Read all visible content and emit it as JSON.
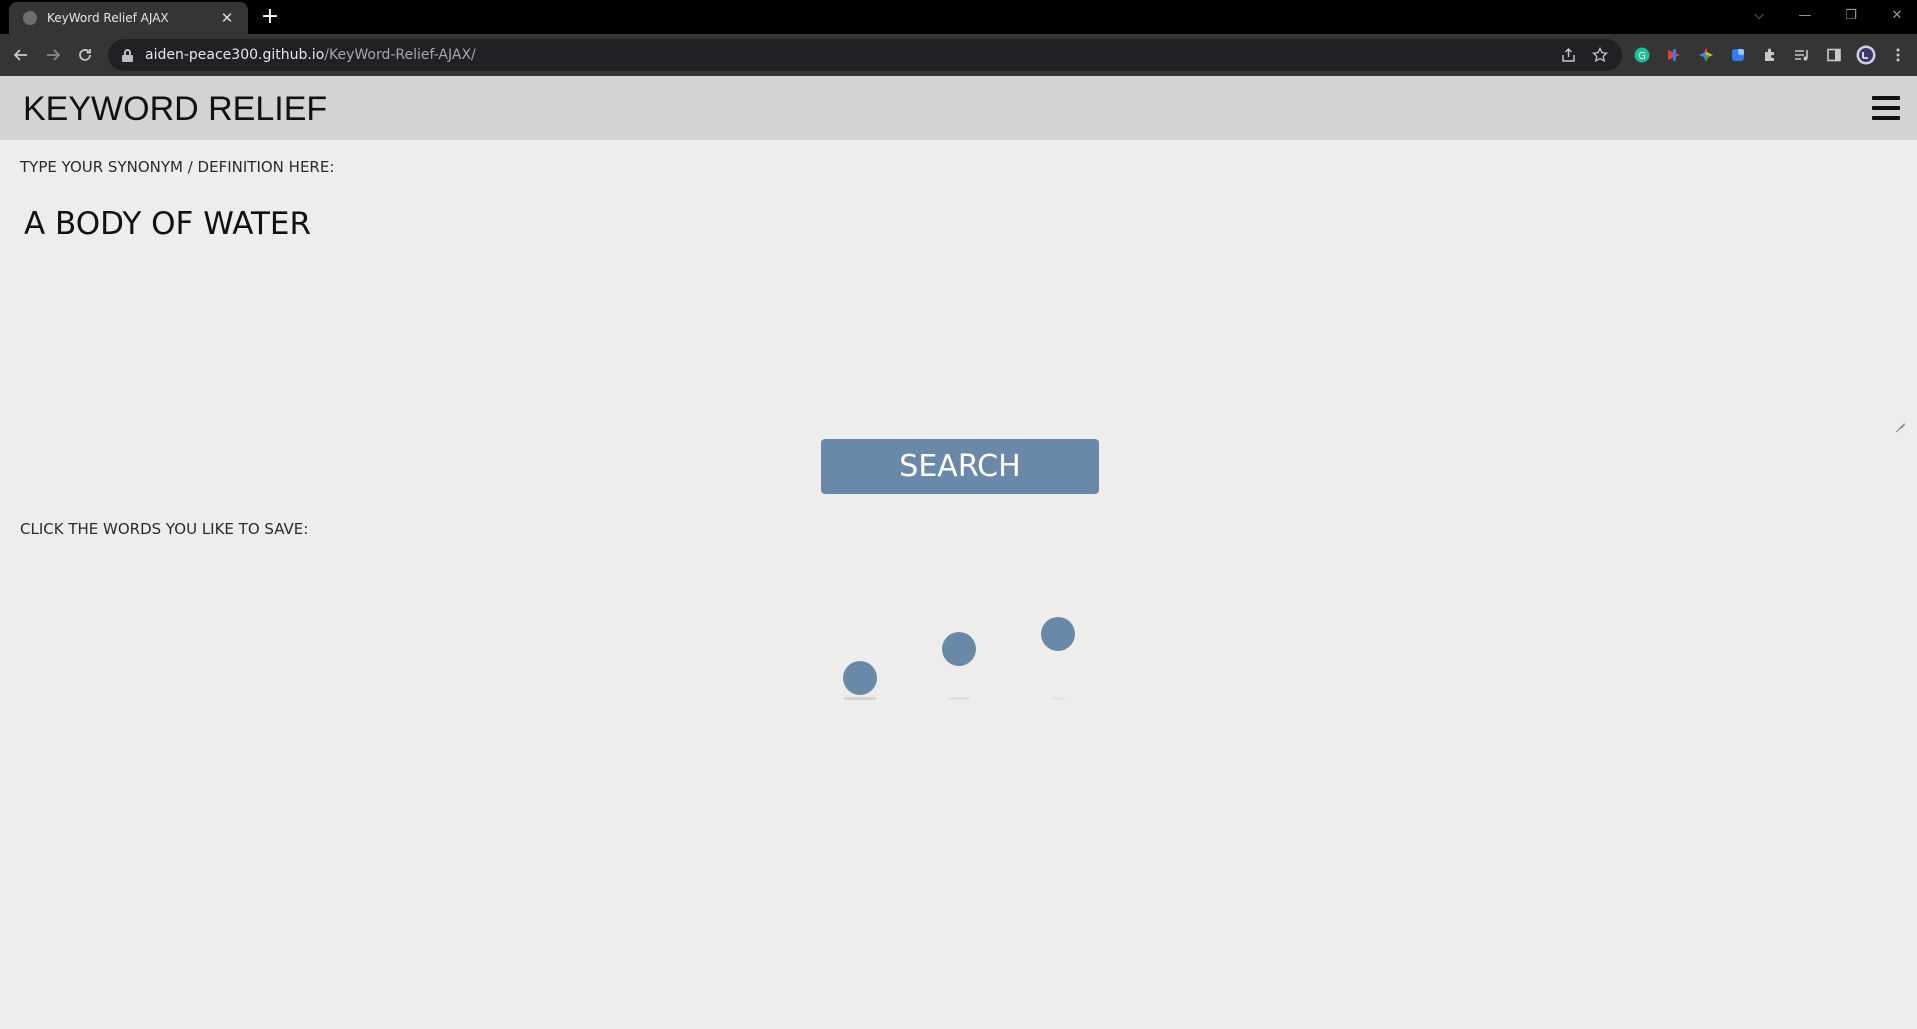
{
  "browser": {
    "tab_title": "KeyWord Relief AJAX",
    "tab_close": "✕",
    "new_tab": "+",
    "url_host": "aiden-peace300.github.io",
    "url_path": "/KeyWord-Relief-AJAX/",
    "window_controls": {
      "tabsearch": "⌵",
      "minimize": "—",
      "restore": "❐",
      "close": "✕"
    }
  },
  "header": {
    "logo": "KEYWORD RELIEF"
  },
  "form": {
    "input_label": "TYPE YOUR SYNONYM / DEFINITION HERE:",
    "input_value": "A BODY OF WATER",
    "search_label": "SEARCH"
  },
  "results": {
    "label": "CLICK THE WORDS YOU LIKE TO SAVE:",
    "loading_dots": 3
  },
  "colors": {
    "accent": "#6a89a8",
    "header_bg": "#d3d3d3",
    "page_bg": "#eeedec"
  }
}
